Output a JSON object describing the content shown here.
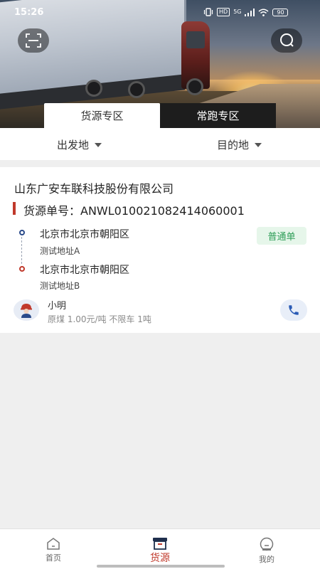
{
  "status_bar": {
    "time": "15:26",
    "hd": "HD",
    "network": "5G",
    "battery": "90"
  },
  "header": {
    "scan_icon": "scan-icon",
    "search_icon": "search-icon"
  },
  "tabs": [
    {
      "label": "货源专区",
      "active": true
    },
    {
      "label": "常跑专区",
      "active": false
    }
  ],
  "filters": {
    "departure": "出发地",
    "destination": "目的地"
  },
  "listing": {
    "company": "山东广安车联科技股份有限公司",
    "order_label": "货源单号：",
    "order_number": "ANWL010021082414060001",
    "origin_city": "北京市北京市朝阳区",
    "origin_address": "测试地址A",
    "dest_city": "北京市北京市朝阳区",
    "dest_address": "测试地址B",
    "badge": "普通单",
    "contact_name": "小明",
    "cargo_info": "原煤 1.00元/吨 不限车 1吨"
  },
  "bottom_nav": [
    {
      "label": "首页",
      "icon": "home-icon",
      "active": false
    },
    {
      "label": "货源",
      "icon": "cargo-box-icon",
      "active": true
    },
    {
      "label": "我的",
      "icon": "profile-icon",
      "active": false
    }
  ],
  "colors": {
    "accent_red": "#c0392b",
    "badge_green": "#2f9e58",
    "route_blue": "#2a4a8a"
  }
}
